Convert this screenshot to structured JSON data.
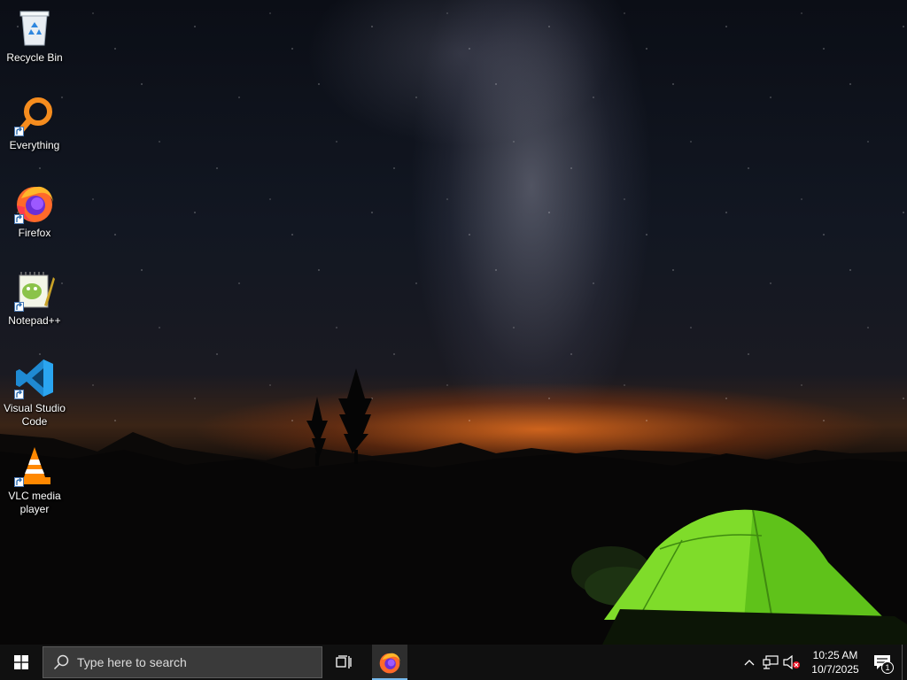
{
  "desktop": {
    "icons": [
      {
        "label": "Recycle Bin",
        "icon": "recycle-bin-icon",
        "shortcut": false
      },
      {
        "label": "Everything",
        "icon": "everything-search-icon",
        "shortcut": true
      },
      {
        "label": "Firefox",
        "icon": "firefox-icon",
        "shortcut": true
      },
      {
        "label": "Notepad++",
        "icon": "notepad-plus-plus-icon",
        "shortcut": true
      },
      {
        "label": "Visual Studio Code",
        "icon": "vscode-icon",
        "shortcut": true
      },
      {
        "label": "VLC media player",
        "icon": "vlc-icon",
        "shortcut": true
      }
    ]
  },
  "taskbar": {
    "search_placeholder": "Type here to search",
    "pinned": [
      {
        "name": "Firefox",
        "icon": "firefox-icon",
        "active": true
      }
    ],
    "clock": {
      "time": "10:25 AM",
      "date": "10/7/2025"
    },
    "notification_count": "1",
    "accent": "#76b9ed"
  }
}
